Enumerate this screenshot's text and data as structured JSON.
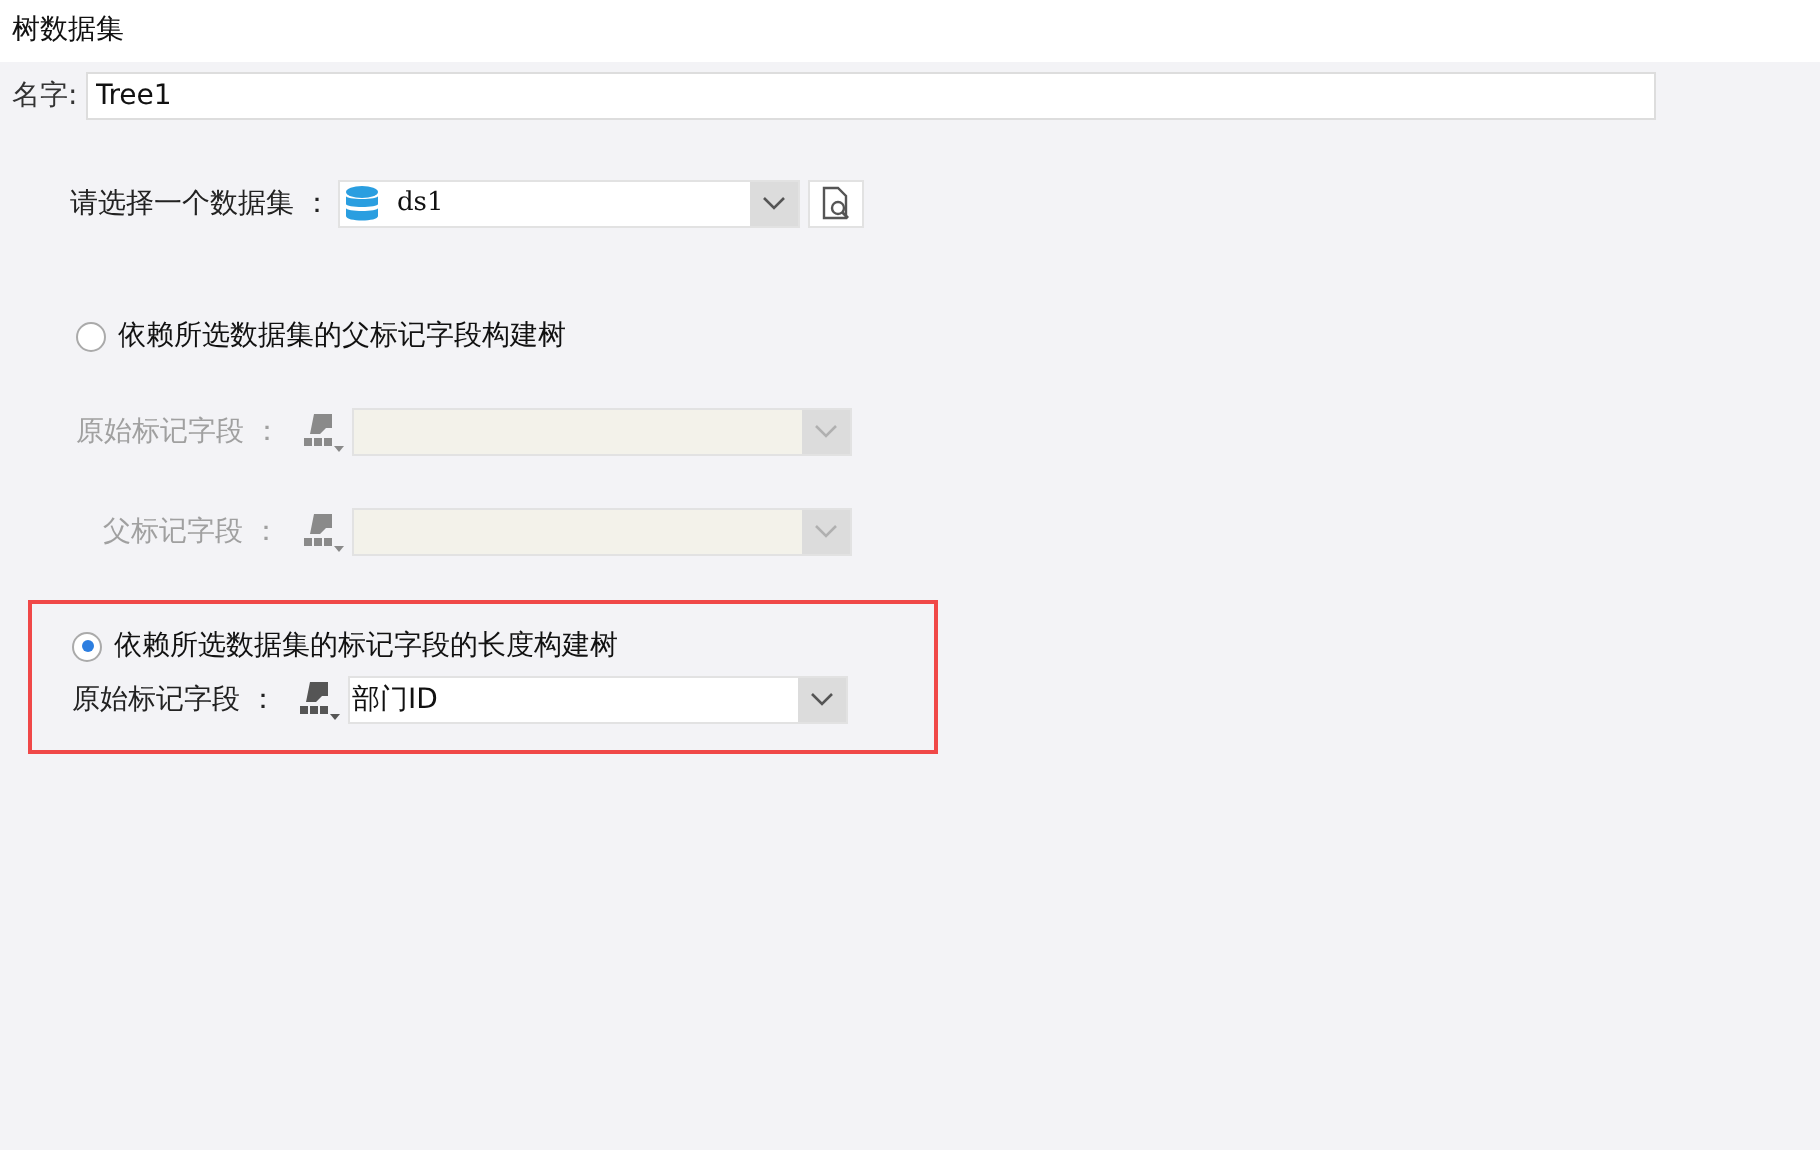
{
  "window": {
    "title": "树数据集"
  },
  "name_field": {
    "label": "名字:",
    "value": "Tree1"
  },
  "dataset": {
    "label": "请选择一个数据集 ：",
    "value": "ds1"
  },
  "options": [
    {
      "label": "依赖所选数据集的父标记字段构建树",
      "selected": false,
      "highlighted": false,
      "fields": [
        {
          "label": "原始标记字段 ："
        },
        {
          "label": "父标记字段 ："
        }
      ]
    },
    {
      "label": "依赖所选数据集的标记字段的长度构建树",
      "selected": true,
      "highlighted": true,
      "fields": [
        {
          "label": "原始标记字段 ：",
          "value": "部门ID"
        }
      ]
    }
  ]
}
